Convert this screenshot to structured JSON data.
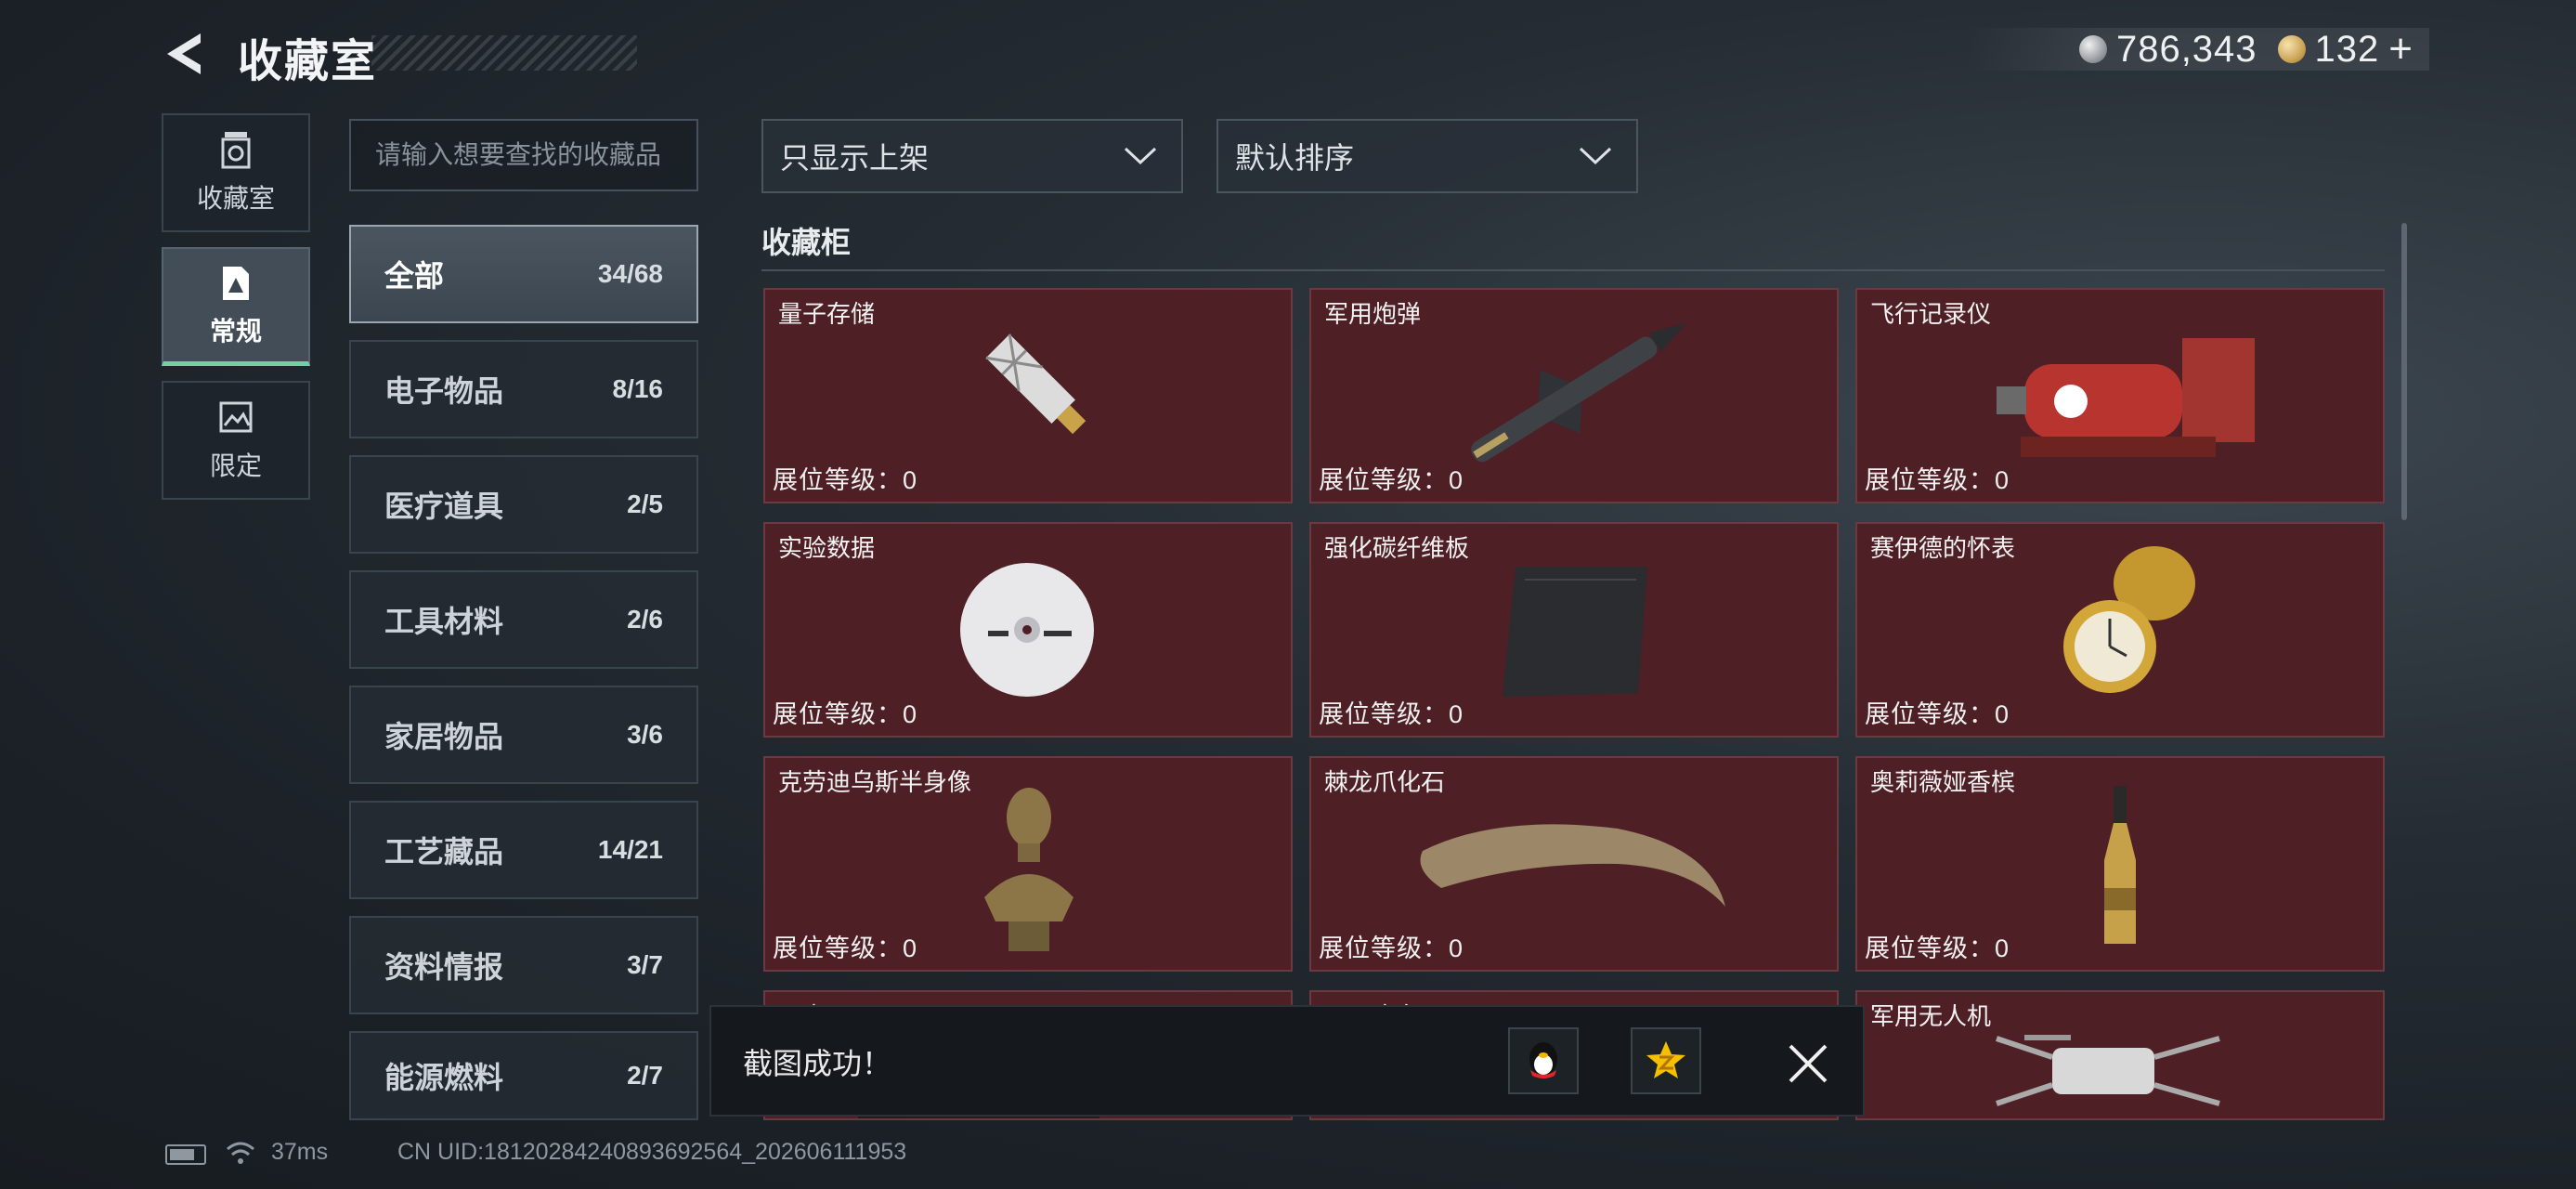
{
  "header": {
    "title": "收藏室"
  },
  "currency": {
    "silver": "786,343",
    "gold": "132",
    "plus": "+"
  },
  "rail": [
    {
      "label": "收藏室",
      "icon": "trophy-icon"
    },
    {
      "label": "常规",
      "icon": "document-icon",
      "active": true
    },
    {
      "label": "限定",
      "icon": "frame-icon"
    }
  ],
  "search": {
    "placeholder": "请输入想要查找的收藏品",
    "value": ""
  },
  "categories": [
    {
      "label": "全部",
      "count": "34/68",
      "active": true
    },
    {
      "label": "电子物品",
      "count": "8/16"
    },
    {
      "label": "医疗道具",
      "count": "2/5"
    },
    {
      "label": "工具材料",
      "count": "2/6"
    },
    {
      "label": "家居物品",
      "count": "3/6"
    },
    {
      "label": "工艺藏品",
      "count": "14/21"
    },
    {
      "label": "资料情报",
      "count": "3/7"
    },
    {
      "label": "能源燃料",
      "count": "2/7"
    }
  ],
  "filters": {
    "show": "只显示上架",
    "sort": "默认排序"
  },
  "section": {
    "title": "收藏柜"
  },
  "level_label": "展位等级：0",
  "items": [
    {
      "name": "量子存储"
    },
    {
      "name": "军用炮弹"
    },
    {
      "name": "飞行记录仪"
    },
    {
      "name": "实验数据"
    },
    {
      "name": "强化碳纤维板"
    },
    {
      "name": "赛伊德的怀表"
    },
    {
      "name": "克劳迪乌斯半身像"
    },
    {
      "name": "棘龙爪化石"
    },
    {
      "name": "奥莉薇娅香槟"
    },
    {
      "name": "显卡"
    },
    {
      "name": "万足金条"
    },
    {
      "name": "军用无人机"
    }
  ],
  "toast": {
    "text": "截图成功！"
  },
  "status": {
    "ping": "37ms",
    "uid": "CN UID:1812028424089369256​4_202606111953"
  },
  "colors": {
    "accent": "#6fd2a4",
    "card_bg": "#4e1f25"
  }
}
